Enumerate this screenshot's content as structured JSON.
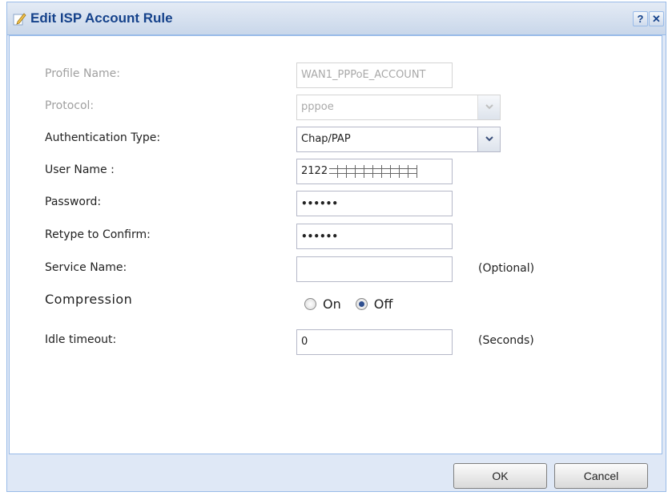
{
  "dialog": {
    "title": "Edit ISP Account Rule",
    "help_label": "?",
    "close_label": "✕"
  },
  "form": {
    "profile_name": {
      "label": "Profile Name:",
      "value": "WAN1_PPPoE_ACCOUNT"
    },
    "protocol": {
      "label": "Protocol:",
      "value": "pppoe"
    },
    "auth_type": {
      "label": "Authentication Type:",
      "value": "Chap/PAP"
    },
    "user_name": {
      "label": "User Name :",
      "value": "2122"
    },
    "password": {
      "label": "Password:",
      "value": "••••••"
    },
    "retype": {
      "label": "Retype to Confirm:",
      "value": "••••••"
    },
    "service_name": {
      "label": "Service Name:",
      "value": "",
      "hint": "(Optional)"
    },
    "compression": {
      "label": "Compression",
      "options": [
        "On",
        "Off"
      ],
      "selected": "Off"
    },
    "idle_timeout": {
      "label": "Idle timeout:",
      "value": "0",
      "hint": "(Seconds)"
    }
  },
  "buttons": {
    "ok": "OK",
    "cancel": "Cancel"
  },
  "icons": {
    "title": "pencil-icon",
    "combo": "chevron-down-icon"
  },
  "colors": {
    "title_text": "#15428b",
    "frame": "#dfe8f6",
    "border": "#99bbe8"
  }
}
